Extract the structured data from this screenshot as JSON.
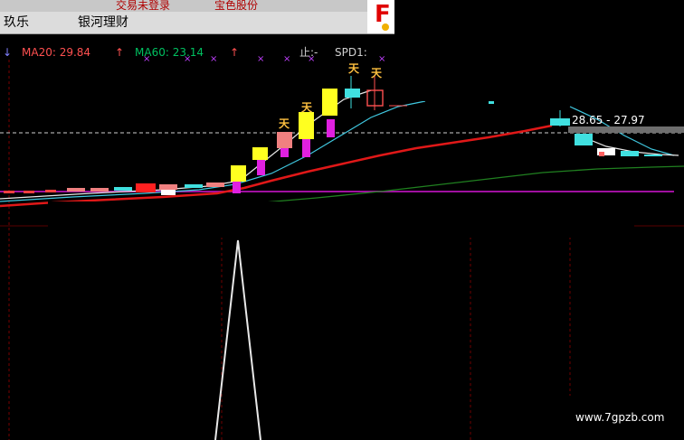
{
  "titlebar": {
    "items": [
      "交易未登录",
      "宝色股份"
    ]
  },
  "menubar": {
    "items": [
      "玖乐",
      "银河理财"
    ]
  },
  "indicators": {
    "arrow": "↓",
    "ma20_label": "MA20: 29.84",
    "ma20_arrow": "↑",
    "ma60_label": "MA60: 23.14",
    "ma60_arrow": "↑",
    "stop_label": "止:-",
    "spd_label": "SPD1:",
    "markers": [
      "×",
      "×",
      "×",
      "×",
      "×",
      "×",
      "×"
    ]
  },
  "annotations": {
    "candle_marker": "天",
    "price_label": "28.65 - 27.97"
  },
  "watermark": "www.7gpzb.com",
  "colors": {
    "background": "#000000",
    "ma20": "#ff5050",
    "ma60": "#00c060",
    "white_line": "#e8e8e8",
    "ma_cyan": "#40c8e0",
    "red_ma": "#e01818",
    "green_ma": "#208020",
    "purple_line": "#a010a0",
    "candle_yellow": "#ffff20",
    "candle_magenta": "#e020e0",
    "candle_pink": "#f08080",
    "candle_cyan": "#40e0e0",
    "candle_red": "#ff2020"
  }
}
